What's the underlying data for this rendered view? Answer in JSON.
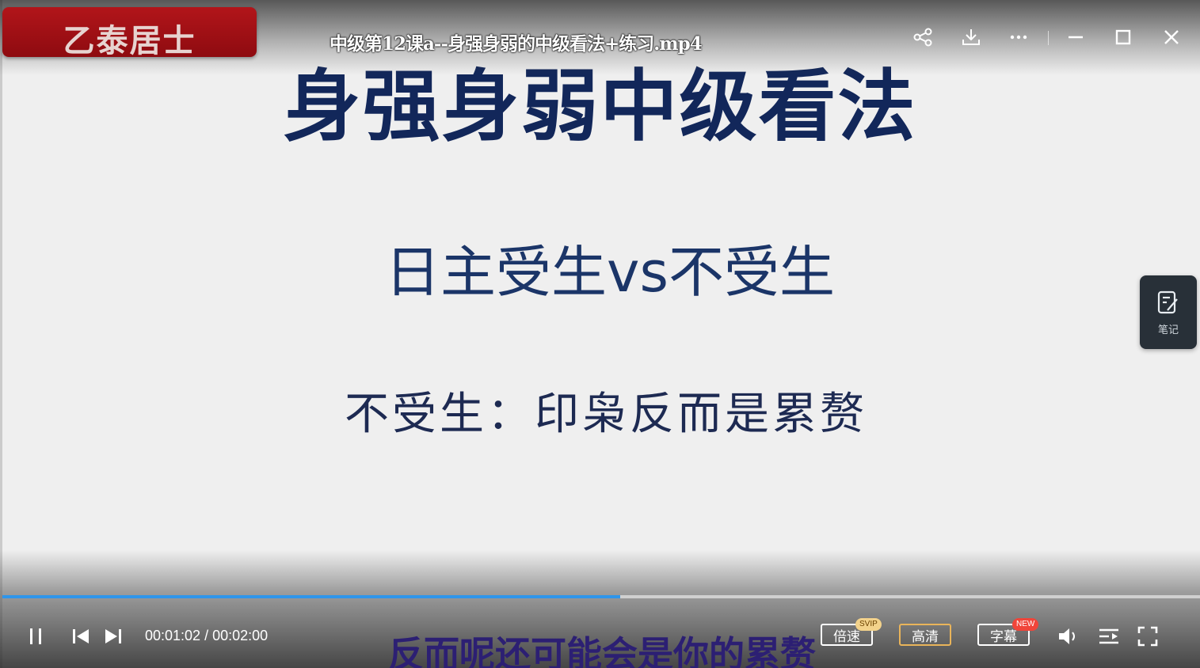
{
  "player": {
    "brand": "乙泰居士",
    "file_title": "中级第12课a--身强身弱的中级看法+练习.mp4",
    "window_controls": [
      "share-icon",
      "download-icon",
      "more-icon",
      "minimize-icon",
      "maximize-icon",
      "close-icon"
    ]
  },
  "slide": {
    "title": "身强身弱中级看法",
    "subtitle": "日主受生vs不受生",
    "line": "不受生：印枭反而是累赘"
  },
  "side_panel": {
    "note_label": "笔记",
    "icon": "note-edit-icon"
  },
  "playback": {
    "current_time": "00:01:02",
    "total_time": "00:02:00",
    "separator": "/",
    "progress": 0.516,
    "caption": "反而呢还可能会是你的累赘"
  },
  "controls": {
    "speed_label": "倍速",
    "speed_badge": "SVIP",
    "quality_label": "高清",
    "caption_label": "字幕",
    "caption_badge": "NEW",
    "accent_color": "#2f95ea"
  }
}
